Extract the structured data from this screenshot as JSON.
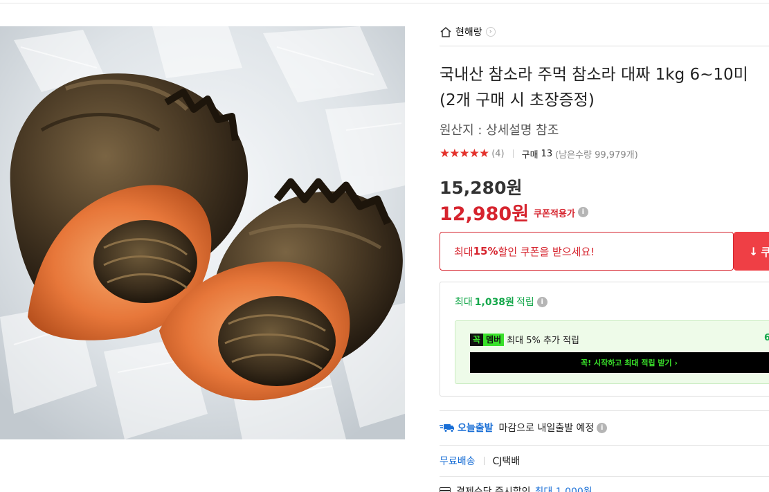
{
  "seller": {
    "name": "현해랑",
    "chevron": "›"
  },
  "product": {
    "title": "국내산 참소라 주먹 참소라 대짜 1kg 6~10미 (2개 구매 시 초장증정)",
    "origin": "원산지 : 상세설명 참조",
    "image_icon": "whelk-photo"
  },
  "rating": {
    "stars": "★★★★★",
    "star_count": 5,
    "review_count": "(4)",
    "purchase_label": "구매",
    "purchase_count": "13",
    "remaining": "(남은수량 99,979개)"
  },
  "price": {
    "original": "15,280원",
    "sale": "12,980원",
    "coupon_applied": "쿠폰적용가",
    "info_icon": "i"
  },
  "coupon": {
    "prefix": "최대 ",
    "percent": "15%",
    "suffix": " 할인 쿠폰을 받으세요!",
    "button_label": "쿠",
    "button_icon": "↓"
  },
  "points": {
    "prefix": "최대",
    "amount": "1,038원",
    "suffix": "적립",
    "member_badge_1": "꼭",
    "member_badge_2": "멤버",
    "member_text": "최대 5% 추가 적립",
    "member_value": "6",
    "member_cta": "꼭! 시작하고 최대 적립 받기 ›"
  },
  "shipping": {
    "today_label": "오늘출발",
    "today_text": "마감으로 내일출발 예정",
    "free_label": "무료배송",
    "courier": "CJ택배",
    "pay_text": "결제수단 즉시할인",
    "pay_highlight": "최대 1,000원"
  },
  "colors": {
    "accent_red": "#d6242e",
    "point_green": "#14a74a",
    "link_blue": "#1a6fd6",
    "member_green": "#39e02a"
  }
}
